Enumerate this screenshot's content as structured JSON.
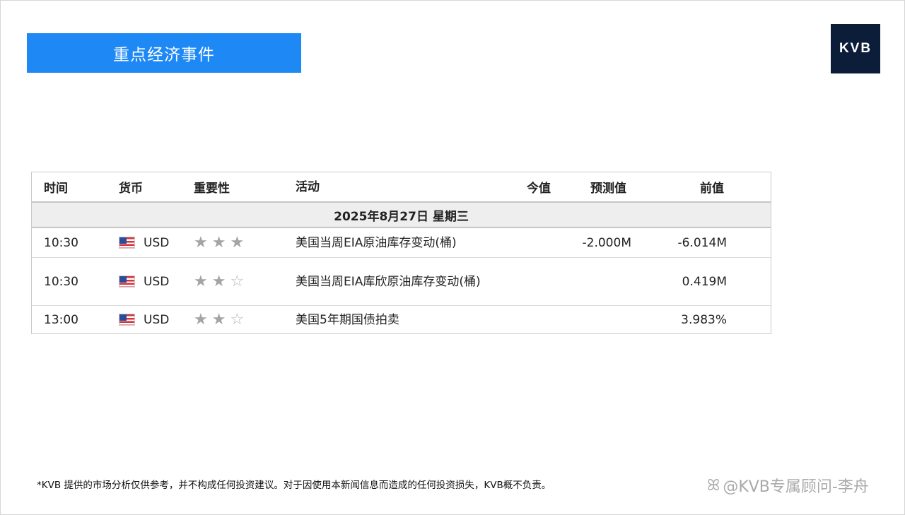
{
  "header": {
    "title": "重点经济事件",
    "logo_text": "KVB"
  },
  "table": {
    "columns": [
      "时间",
      "货币",
      "重要性",
      "活动",
      "今值",
      "预测值",
      "前值"
    ],
    "date_label": "2025年8月27日  星期三",
    "rows": [
      {
        "time": "10:30",
        "currency": "USD",
        "importance": 3,
        "event": "美国当周EIA原油库存变动(桶)",
        "actual": "",
        "forecast": "-2.000M",
        "previous": "-6.014M"
      },
      {
        "time": "10:30",
        "currency": "USD",
        "importance": 2,
        "event": "美国当周EIA库欣原油库存变动(桶)",
        "actual": "",
        "forecast": "",
        "previous": "0.419M"
      },
      {
        "time": "13:00",
        "currency": "USD",
        "importance": 2,
        "event": "美国5年期国债拍卖",
        "actual": "",
        "forecast": "",
        "previous": "3.983%"
      }
    ]
  },
  "footer": {
    "disclaimer": "*KVB 提供的市场分析仅供参考，并不构成任何投资建议。对于因使用本新闻信息而造成的任何投资损失，KVB概不负责。",
    "watermark": "@KVB专属顾问-李舟"
  },
  "colors": {
    "banner": "#1e88f5",
    "logo_bg": "#0c1d3a",
    "star_filled": "#a4a4a4",
    "row_date_bg": "#eeeeee"
  },
  "icons": {
    "flag": "us-flag-icon",
    "star_filled": "star-filled-icon",
    "star_empty": "star-outline-icon",
    "watermark": "zhihu-icon"
  }
}
